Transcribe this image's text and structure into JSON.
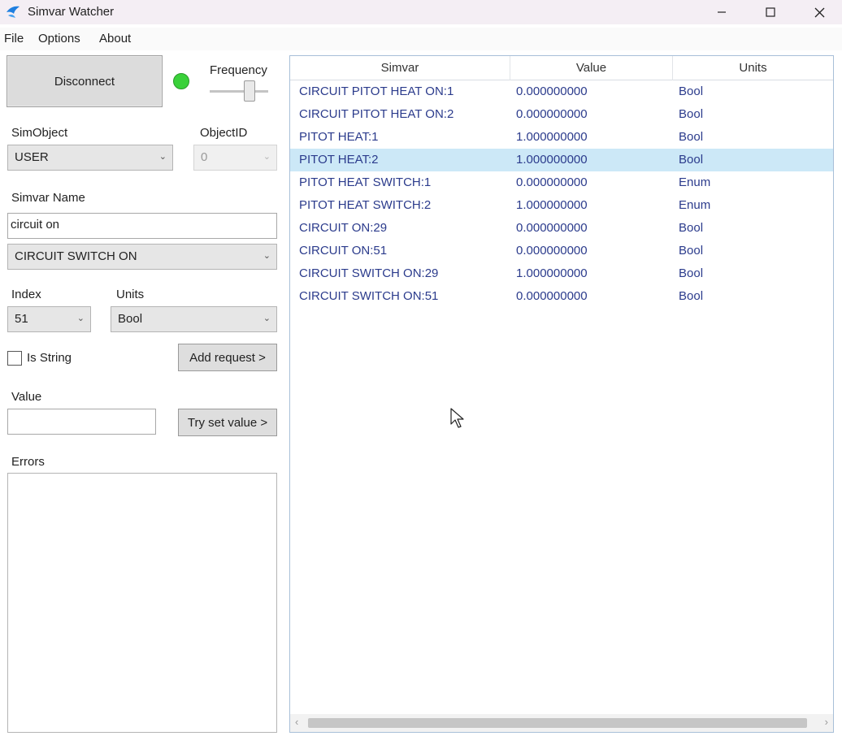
{
  "window": {
    "title": "Simvar Watcher",
    "icons": {
      "app": "blue-bird-app-icon",
      "minimize": "minimize-icon",
      "maximize": "maximize-icon",
      "close": "close-icon"
    }
  },
  "menu": [
    "File",
    "Options",
    "About"
  ],
  "controls": {
    "disconnect_label": "Disconnect",
    "connection_status_color": "#3ad13a",
    "frequency_label": "Frequency",
    "simobject_label": "SimObject",
    "simobject_value": "USER",
    "objectid_label": "ObjectID",
    "objectid_value": "0",
    "simvar_name_label": "Simvar Name",
    "simvar_name_value": "circuit on",
    "simvar_select_value": "CIRCUIT SWITCH ON",
    "index_label": "Index",
    "index_value": "51",
    "units_label": "Units",
    "units_value": "Bool",
    "is_string_label": "Is String",
    "add_request_label": "Add request >",
    "value_label": "Value",
    "value_value": "",
    "try_set_label": "Try set value >",
    "errors_label": "Errors"
  },
  "grid": {
    "columns": [
      "Simvar",
      "Value",
      "Units"
    ],
    "selected_row_index": 3,
    "rows": [
      {
        "simvar": "CIRCUIT PITOT HEAT ON:1",
        "value": "0.000000000",
        "units": "Bool"
      },
      {
        "simvar": "CIRCUIT PITOT HEAT ON:2",
        "value": "0.000000000",
        "units": "Bool"
      },
      {
        "simvar": "PITOT HEAT:1",
        "value": "1.000000000",
        "units": "Bool"
      },
      {
        "simvar": "PITOT HEAT:2",
        "value": "1.000000000",
        "units": "Bool"
      },
      {
        "simvar": "PITOT HEAT SWITCH:1",
        "value": "0.000000000",
        "units": "Enum"
      },
      {
        "simvar": "PITOT HEAT SWITCH:2",
        "value": "1.000000000",
        "units": "Enum"
      },
      {
        "simvar": "CIRCUIT ON:29",
        "value": "0.000000000",
        "units": "Bool"
      },
      {
        "simvar": "CIRCUIT ON:51",
        "value": "0.000000000",
        "units": "Bool"
      },
      {
        "simvar": "CIRCUIT SWITCH ON:29",
        "value": "1.000000000",
        "units": "Bool"
      },
      {
        "simvar": "CIRCUIT SWITCH ON:51",
        "value": "0.000000000",
        "units": "Bool"
      }
    ]
  }
}
